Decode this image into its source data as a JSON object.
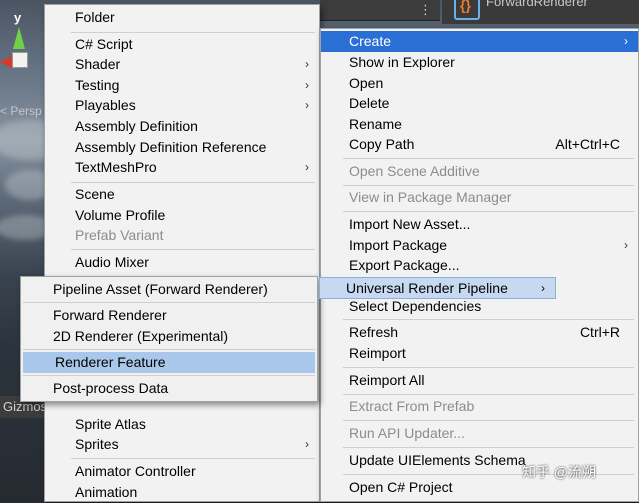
{
  "scene": {
    "axis_label": "y",
    "projection_label": "< Persp",
    "gizmos_label": "Gizmos"
  },
  "inspector": {
    "asset_name": "ForwardRenderer"
  },
  "left_menu": {
    "items": [
      {
        "label": "Folder"
      },
      {
        "label": "C# Script"
      },
      {
        "label": "Shader",
        "submenu": true
      },
      {
        "label": "Testing",
        "submenu": true
      },
      {
        "label": "Playables",
        "submenu": true
      },
      {
        "label": "Assembly Definition"
      },
      {
        "label": "Assembly Definition Reference"
      },
      {
        "label": "TextMeshPro",
        "submenu": true
      },
      {
        "label": "Scene"
      },
      {
        "label": "Volume Profile"
      },
      {
        "label": "Prefab Variant",
        "disabled": true
      },
      {
        "label": "Audio Mixer"
      },
      {
        "label": "Sprite Atlas"
      },
      {
        "label": "Sprites",
        "submenu": true
      },
      {
        "label": "Animator Controller"
      },
      {
        "label": "Animation"
      }
    ]
  },
  "right_menu": {
    "items": [
      {
        "label": "Create",
        "submenu": true,
        "active": true
      },
      {
        "label": "Show in Explorer"
      },
      {
        "label": "Open"
      },
      {
        "label": "Delete"
      },
      {
        "label": "Rename"
      },
      {
        "label": "Copy Path",
        "shortcut": "Alt+Ctrl+C"
      },
      {
        "label": "Open Scene Additive",
        "disabled": true
      },
      {
        "label": "View in Package Manager",
        "disabled": true
      },
      {
        "label": "Import New Asset..."
      },
      {
        "label": "Import Package",
        "submenu": true
      },
      {
        "label": "Export Package..."
      },
      {
        "label": "Select Dependencies"
      },
      {
        "label": "Refresh",
        "shortcut": "Ctrl+R"
      },
      {
        "label": "Reimport"
      },
      {
        "label": "Reimport All"
      },
      {
        "label": "Extract From Prefab",
        "disabled": true
      },
      {
        "label": "Run API Updater...",
        "disabled": true
      },
      {
        "label": "Update UIElements Schema"
      },
      {
        "label": "Open C# Project"
      }
    ]
  },
  "urp_item": {
    "label": "Universal Render Pipeline",
    "submenu": true
  },
  "urp_submenu": {
    "items": [
      {
        "label": "Pipeline Asset (Forward Renderer)"
      },
      {
        "label": "Forward Renderer"
      },
      {
        "label": "2D Renderer (Experimental)"
      },
      {
        "label": "Renderer Feature",
        "selected": true
      },
      {
        "label": "Post-process Data"
      }
    ]
  },
  "watermark": "知乎 @流朔",
  "colors": {
    "highlight": "#2a6fd3",
    "selection": "#a9c7ea",
    "menu_bg": "#f2f2f2"
  }
}
